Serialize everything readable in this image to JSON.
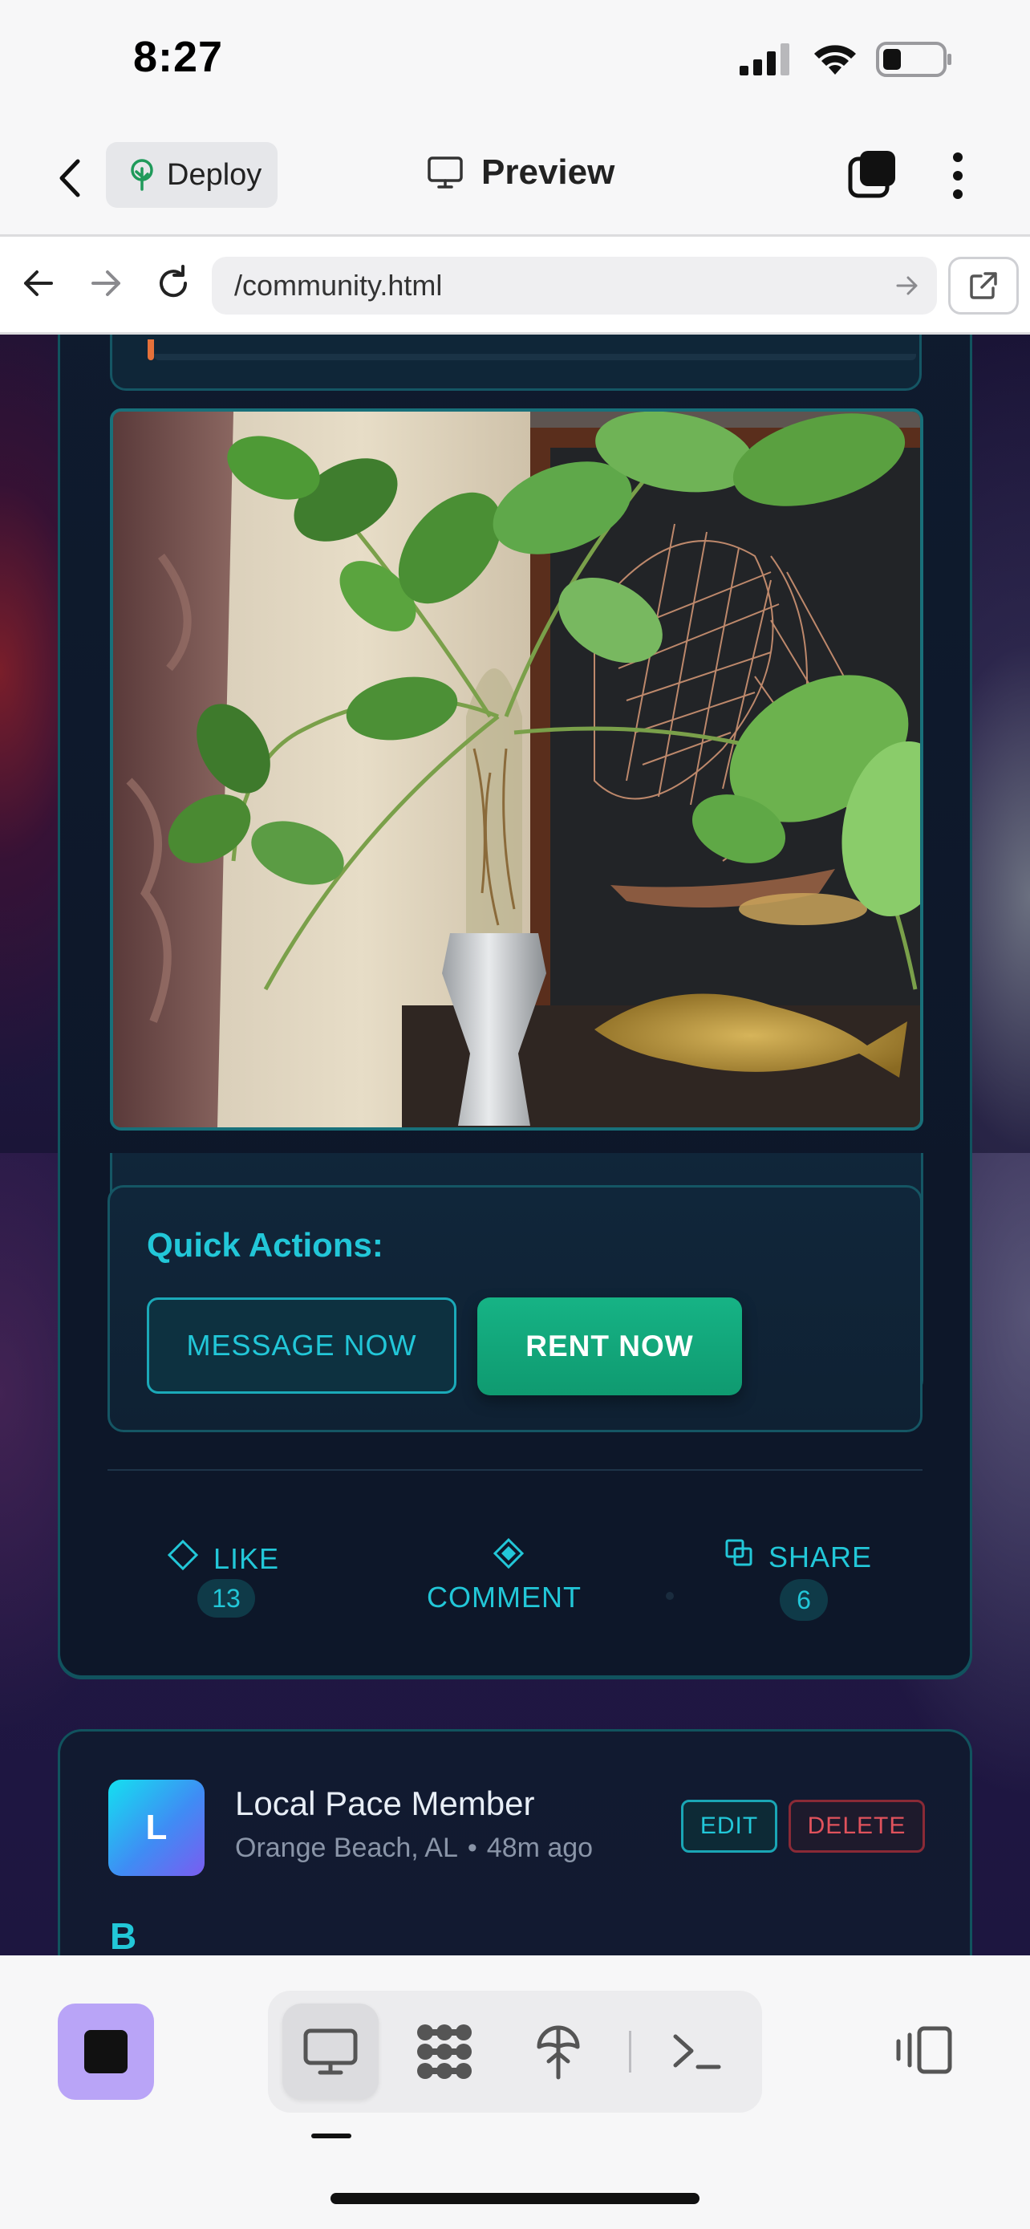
{
  "status_bar": {
    "time": "8:27"
  },
  "app_bar": {
    "deploy_label": "Deploy",
    "title": "Preview"
  },
  "browser": {
    "url": "/community.html"
  },
  "post": {
    "quick_actions_label": "Quick Actions:",
    "message_button": "MESSAGE NOW",
    "rent_button": "RENT NOW",
    "like_label": "LIKE",
    "like_count": "13",
    "comment_label": "COMMENT",
    "share_label": "SHARE",
    "share_count": "6"
  },
  "next_post": {
    "avatar_letter": "L",
    "author": "Local Pace Member",
    "location": "Orange Beach, AL",
    "time": "48m ago",
    "separator": "•",
    "edit_label": "EDIT",
    "delete_label": "DELETE",
    "body_start": "B"
  },
  "colors": {
    "accent_teal": "#22c7d8",
    "rent_green": "#12a47a",
    "delete_red": "#e0525c",
    "deploy_icon_green": "#1f9a5a",
    "stop_button_purple": "#b9a4f7"
  },
  "icons": {
    "back": "chevron-left-icon",
    "deploy": "deploy-tree-icon",
    "preview": "monitor-icon",
    "tabs": "tabs-icon",
    "more": "vertical-dots-icon",
    "browser_back": "arrow-left-icon",
    "browser_forward": "arrow-right-icon",
    "reload": "reload-icon",
    "url_go": "arrow-right-small-icon",
    "external": "external-link-icon",
    "like": "diamond-outline-icon",
    "comment": "diamond-filled-icon",
    "share": "share-squares-icon",
    "stop": "stop-square-icon",
    "desktop_tab": "desktop-icon",
    "blocks_tab": "blocks-icon",
    "deploy_tab": "deploy-tree-icon",
    "terminal_tab": "terminal-icon",
    "split_view": "split-view-icon"
  }
}
